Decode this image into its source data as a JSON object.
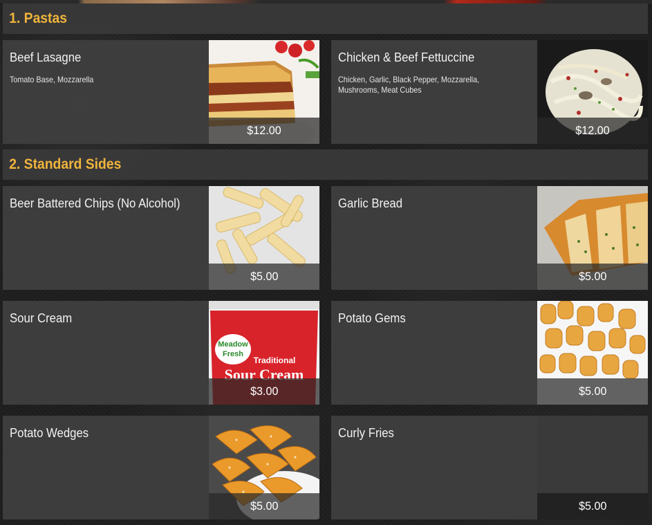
{
  "sections": [
    {
      "title": "1. Pastas",
      "items": [
        {
          "name": "Beef Lasagne",
          "description": "Tomato Base, Mozzarella",
          "price": "$12.00",
          "image": "lasagne-photo"
        },
        {
          "name": "Chicken & Beef Fettuccine",
          "description": "Chicken, Garlic, Black Pepper, Mozzarella, Mushrooms, Meat Cubes",
          "price": "$12.00",
          "image": "fettuccine-photo"
        }
      ]
    },
    {
      "title": "2. Standard Sides",
      "items": [
        {
          "name": "Beer Battered Chips (No Alcohol)",
          "description": "",
          "price": "$5.00",
          "image": "chips-photo"
        },
        {
          "name": "Garlic Bread",
          "description": "",
          "price": "$5.00",
          "image": "garlic-bread-photo"
        },
        {
          "name": "Sour Cream",
          "description": "",
          "price": "$3.00",
          "image": "sour-cream-tub-photo",
          "image_text": {
            "brand_line1": "Meadow",
            "brand_line2": "Fresh",
            "product_line1": "Traditional",
            "product_line2": "Sour Cream"
          }
        },
        {
          "name": "Potato Gems",
          "description": "",
          "price": "$5.00",
          "image": "potato-gems-photo"
        },
        {
          "name": "Potato Wedges",
          "description": "",
          "price": "$5.00",
          "image": "potato-wedges-photo"
        },
        {
          "name": "Curly Fries",
          "description": "",
          "price": "$5.00",
          "image": "none"
        }
      ]
    }
  ],
  "colors": {
    "section_title": "#f0b43c",
    "card_background": "#3e3e3e",
    "page_background": "#1e1e1e"
  }
}
